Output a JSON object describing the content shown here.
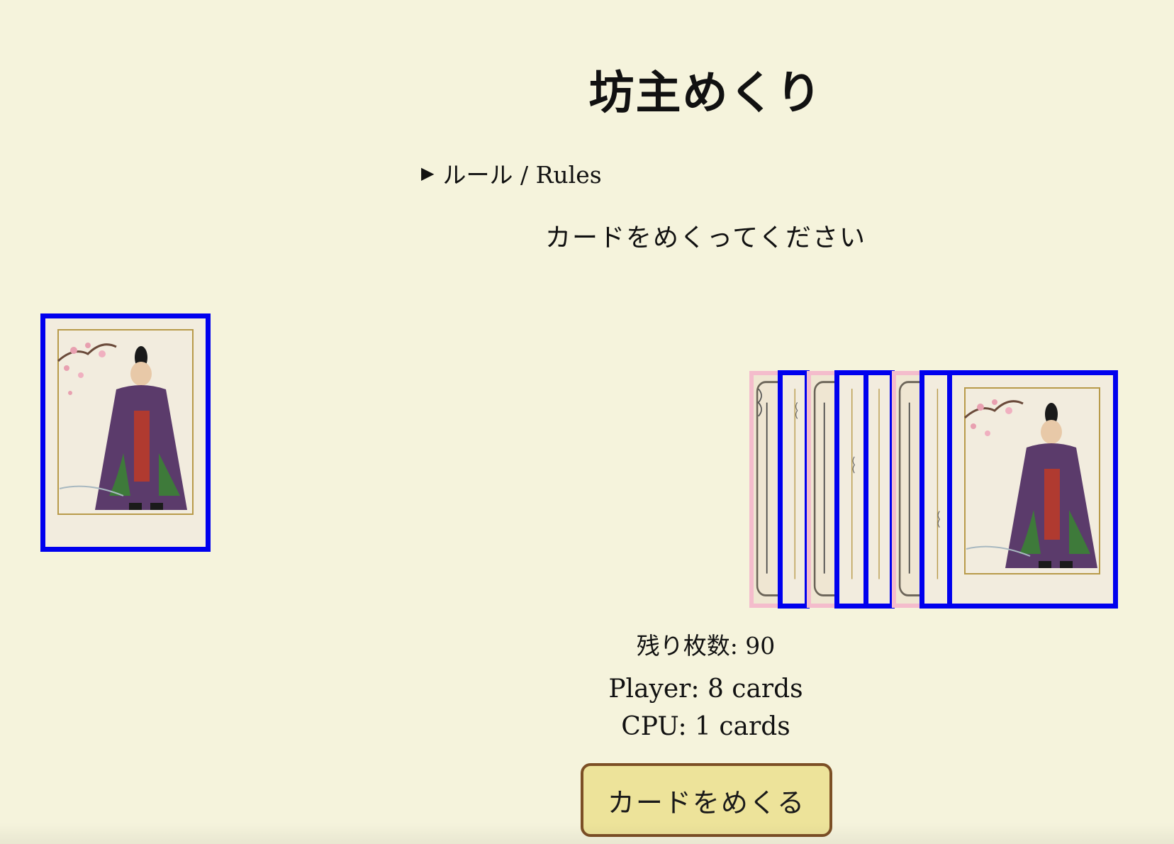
{
  "title": "坊主めくり",
  "rules": {
    "label": "ルール / Rules"
  },
  "message": "カードをめくってください",
  "stats": {
    "remaining": "残り枚数: 90",
    "player": "Player: 8 cards",
    "cpu": "CPU: 1 cards"
  },
  "actions": {
    "flip_label": "カードをめくる"
  },
  "colors": {
    "background": "#f5f3dc",
    "card_border_highlight": "#0000ee",
    "card_border_normal": "#f4bccc",
    "button_fill": "#ede39a",
    "button_border": "#7c4f25"
  },
  "icons": {
    "rules_toggle": "disclosure-triangle"
  }
}
